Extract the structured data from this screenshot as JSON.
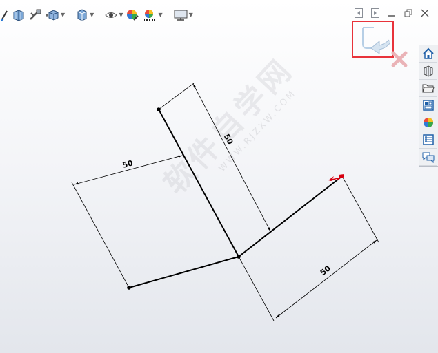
{
  "toolbar": {
    "icons": [
      "sketch-icon",
      "section-view-icon",
      "view-settings-icon",
      "view-orientation-icon",
      "display-style-icon",
      "hide-show-icon",
      "edit-appearance-icon",
      "apply-scene-icon",
      "view-setting-monitor-icon"
    ]
  },
  "dimensions": {
    "top_left": "50",
    "top_center": "50",
    "bottom_right": "50"
  },
  "watermark": {
    "text": "软件自学网",
    "url": "WWW.RJZXW.COM"
  },
  "colors": {
    "highlight_box": "#e8333b",
    "sketch_line": "#000000",
    "handle": "#d7000f"
  }
}
